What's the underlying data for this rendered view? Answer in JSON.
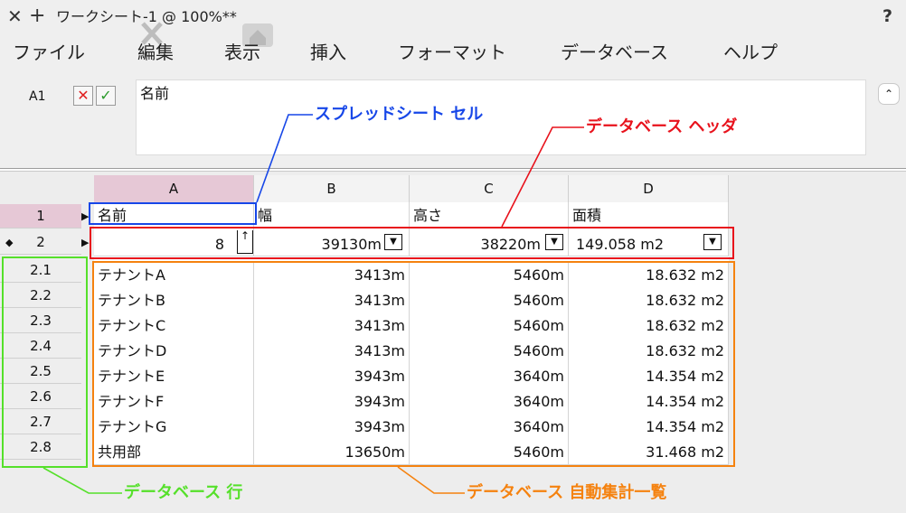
{
  "titlebar": {
    "close_glyph": "✕",
    "plus_glyph": "+",
    "title": "ワークシート-1 @ 100%**",
    "help_glyph": "?"
  },
  "menubar": {
    "items": [
      "ファイル",
      "編集",
      "表示",
      "挿入",
      "フォーマット",
      "データベース",
      "ヘルプ"
    ]
  },
  "editbar": {
    "cell_ref": "A1",
    "cancel_glyph": "✕",
    "accept_glyph": "✓",
    "formula_text": "名前",
    "collapse_glyph": "⌃"
  },
  "columns": [
    "A",
    "B",
    "C",
    "D"
  ],
  "rows": {
    "header_labels": [
      "1",
      "2"
    ],
    "sub_labels": [
      "2.1",
      "2.2",
      "2.3",
      "2.4",
      "2.5",
      "2.6",
      "2.7",
      "2.8"
    ]
  },
  "row1": [
    "名前",
    "幅",
    "高さ",
    "面積"
  ],
  "row2": [
    "8",
    "39130m",
    "38220m",
    "149.058 m2"
  ],
  "subrows": [
    [
      "テナントA",
      "3413m",
      "5460m",
      "18.632 m2"
    ],
    [
      "テナントB",
      "3413m",
      "5460m",
      "18.632 m2"
    ],
    [
      "テナントC",
      "3413m",
      "5460m",
      "18.632 m2"
    ],
    [
      "テナントD",
      "3413m",
      "5460m",
      "18.632 m2"
    ],
    [
      "テナントE",
      "3943m",
      "3640m",
      "14.354 m2"
    ],
    [
      "テナントF",
      "3943m",
      "3640m",
      "14.354 m2"
    ],
    [
      "テナントG",
      "3943m",
      "3640m",
      "14.354 m2"
    ],
    [
      "共用部",
      "13650m",
      "5460m",
      "31.468 m2"
    ]
  ],
  "annotations": {
    "spreadsheet_cell": "スプレッドシート セル",
    "database_header": "データベース ヘッダ",
    "database_row": "データベース 行",
    "database_summary": "データベース 自動集計一覧"
  },
  "colors": {
    "blue": "#1747e8",
    "red": "#e8121c",
    "green": "#55e02a",
    "orange": "#f5820f",
    "selected_header": "#e6c8d6"
  },
  "icons": {
    "row_marker": "◆",
    "row_arrow": "▶",
    "dropdown": "▼",
    "sort": "↑"
  }
}
